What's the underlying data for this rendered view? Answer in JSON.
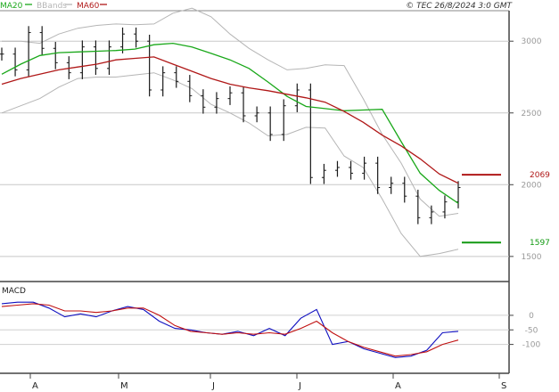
{
  "header": {
    "legend": [
      {
        "label": "MA20",
        "color": "#1aa81a"
      },
      {
        "label": "BBands",
        "color": "#b5b5b5"
      },
      {
        "label": "MA60",
        "color": "#b01818"
      }
    ],
    "source_stamp": "© TEC 26/8/2024 3:0 GMT"
  },
  "chart_data": [
    {
      "type": "line",
      "panel": "price",
      "ylim": [
        1350,
        3200
      ],
      "yticks": [
        {
          "value": 3000,
          "label": "3000"
        },
        {
          "value": 2500,
          "label": "2500"
        },
        {
          "value": 2000,
          "label": "2000"
        },
        {
          "value": 1500,
          "label": "1500"
        }
      ],
      "grid": true,
      "markers": [
        {
          "value": 2069,
          "label": "2069",
          "color": "#b01818"
        },
        {
          "value": 1597,
          "label": "1597",
          "color": "#119911"
        }
      ],
      "x_labels": [
        "A",
        "M",
        "J",
        "J",
        "A",
        "S"
      ],
      "series": [
        {
          "name": "MA20",
          "color": "#1aa81a",
          "values": [
            2770,
            2840,
            2900,
            2920,
            2925,
            2930,
            2935,
            2945,
            2975,
            2985,
            2960,
            2915,
            2870,
            2810,
            2715,
            2615,
            2545,
            2530,
            2515,
            2520,
            2525,
            2300,
            2080,
            1960,
            1870
          ]
        },
        {
          "name": "MA60",
          "color": "#b01818",
          "values": [
            2700,
            2740,
            2770,
            2800,
            2820,
            2840,
            2870,
            2880,
            2890,
            2840,
            2790,
            2740,
            2700,
            2675,
            2655,
            2630,
            2605,
            2575,
            2510,
            2435,
            2345,
            2270,
            2180,
            2075,
            2010
          ]
        },
        {
          "name": "BBands",
          "color": "#b5b5b5",
          "values": [
            3000,
            3000,
            2985,
            3050,
            3090,
            3110,
            3120,
            3115,
            3120,
            3195,
            3230,
            3170,
            3050,
            2950,
            2870,
            2800,
            2810,
            2835,
            2830,
            2600,
            2350,
            2150,
            1900,
            1780,
            1800
          ]
        },
        {
          "name": "BBands",
          "color": "#b5b5b5",
          "values": [
            2500,
            2550,
            2600,
            2680,
            2740,
            2750,
            2750,
            2765,
            2780,
            2730,
            2670,
            2560,
            2500,
            2430,
            2340,
            2350,
            2400,
            2395,
            2200,
            2120,
            1900,
            1660,
            1500,
            1520,
            1550
          ]
        },
        {
          "name": "Close",
          "type": "ohlc",
          "color": "#1a1a1a",
          "values": [
            2910,
            2800,
            3060,
            2950,
            2850,
            2780,
            2960,
            2810,
            2960,
            3050,
            3000,
            2660,
            2780,
            2720,
            2620,
            2540,
            2600,
            2640,
            2480,
            2500,
            2350,
            2550,
            2660,
            2050,
            2100,
            2120,
            2080,
            2150,
            1980,
            2010,
            1920,
            1770,
            1810,
            1880,
            1980
          ]
        }
      ]
    },
    {
      "type": "line",
      "panel": "macd",
      "title": "MACD",
      "ylim": [
        -190,
        110
      ],
      "yticks": [
        {
          "value": 0,
          "label": "0"
        },
        {
          "value": -50,
          "label": "-50"
        },
        {
          "value": -100,
          "label": "-100"
        }
      ],
      "grid": true,
      "series": [
        {
          "name": "MACD",
          "color": "#1010c0",
          "values": [
            40,
            45,
            45,
            25,
            -5,
            5,
            -5,
            15,
            30,
            20,
            -20,
            -45,
            -50,
            -60,
            -65,
            -55,
            -70,
            -45,
            -70,
            -10,
            20,
            -100,
            -90,
            -115,
            -130,
            -145,
            -140,
            -120,
            -60,
            -55
          ]
        },
        {
          "name": "Signal",
          "color": "#c01010",
          "values": [
            30,
            35,
            40,
            35,
            15,
            15,
            10,
            15,
            25,
            25,
            0,
            -35,
            -55,
            -60,
            -65,
            -60,
            -65,
            -60,
            -65,
            -45,
            -20,
            -60,
            -90,
            -110,
            -125,
            -140,
            -135,
            -125,
            -100,
            -85
          ]
        }
      ]
    }
  ]
}
